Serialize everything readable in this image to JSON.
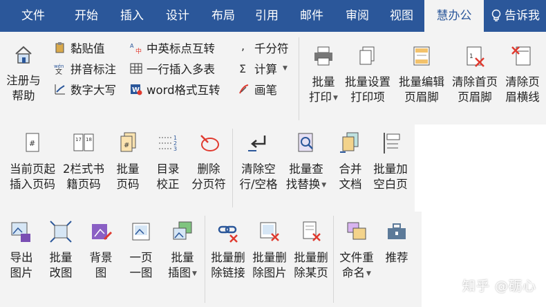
{
  "tabs": [
    {
      "label": "文件"
    },
    {
      "label": "开始"
    },
    {
      "label": "插入"
    },
    {
      "label": "设计"
    },
    {
      "label": "布局"
    },
    {
      "label": "引用"
    },
    {
      "label": "邮件"
    },
    {
      "label": "审阅"
    },
    {
      "label": "视图"
    },
    {
      "label": "慧办公"
    }
  ],
  "tell_me": "告诉我",
  "row1": {
    "register": {
      "line1": "注册与",
      "line2": "帮助"
    },
    "small_col1": [
      "黏贴值",
      "拼音标注",
      "数字大写"
    ],
    "small_col2": [
      "中英标点互转",
      "一行插入多表",
      "word格式互转"
    ],
    "small_col3": [
      "千分符",
      "计算",
      "画笔"
    ],
    "batch_print": {
      "line1": "批量",
      "line2": "打印"
    },
    "batch_settings": {
      "line1": "批量设置",
      "line2": "打印项"
    },
    "batch_edit_header": {
      "line1": "批量编辑",
      "line2": "页眉脚"
    },
    "clear_first_header": {
      "line1": "清除首页",
      "line2": "页眉脚"
    },
    "clear_header_line": {
      "line1": "清除页",
      "line2": "眉横线"
    }
  },
  "row2": {
    "current_page": {
      "line1": "当前页起",
      "line2": "插入页码"
    },
    "two_col": {
      "line1": "2栏式书",
      "line2": "籍页码"
    },
    "batch_page": {
      "line1": "批量",
      "line2": "页码"
    },
    "toc": {
      "line1": "目录",
      "line2": "校正"
    },
    "delete_break": {
      "line1": "删除",
      "line2": "分页符"
    },
    "clear_blank": {
      "line1": "清除空",
      "line2": "行/空格"
    },
    "batch_find": {
      "line1": "批量查",
      "line2": "找替换"
    },
    "merge_docs": {
      "line1": "合并",
      "line2": "文档"
    },
    "add_blank_page": {
      "line1": "批量加",
      "line2": "空白页"
    }
  },
  "row3": {
    "export_images": {
      "line1": "导出",
      "line2": "图片"
    },
    "batch_resize": {
      "line1": "批量",
      "line2": "改图"
    },
    "background": {
      "line1": "背景",
      "line2": "图"
    },
    "one_page": {
      "line1": "一页",
      "line2": "一图"
    },
    "batch_insert": {
      "line1": "批量",
      "line2": "插图"
    },
    "del_links": {
      "line1": "批量删",
      "line2": "除链接"
    },
    "del_images": {
      "line1": "批量删",
      "line2": "除图片"
    },
    "del_pages": {
      "line1": "批量删",
      "line2": "除某页"
    },
    "rename_files": {
      "line1": "文件重",
      "line2": "命名"
    },
    "recommend": {
      "line1": "推荐",
      "line2": ""
    }
  },
  "watermark": "知乎 @砺心",
  "colors": {
    "tabbar": "#2b579a",
    "ribbon": "#f3f3f3",
    "accent_red": "#e03a2f",
    "accent_blue": "#2b579a"
  }
}
